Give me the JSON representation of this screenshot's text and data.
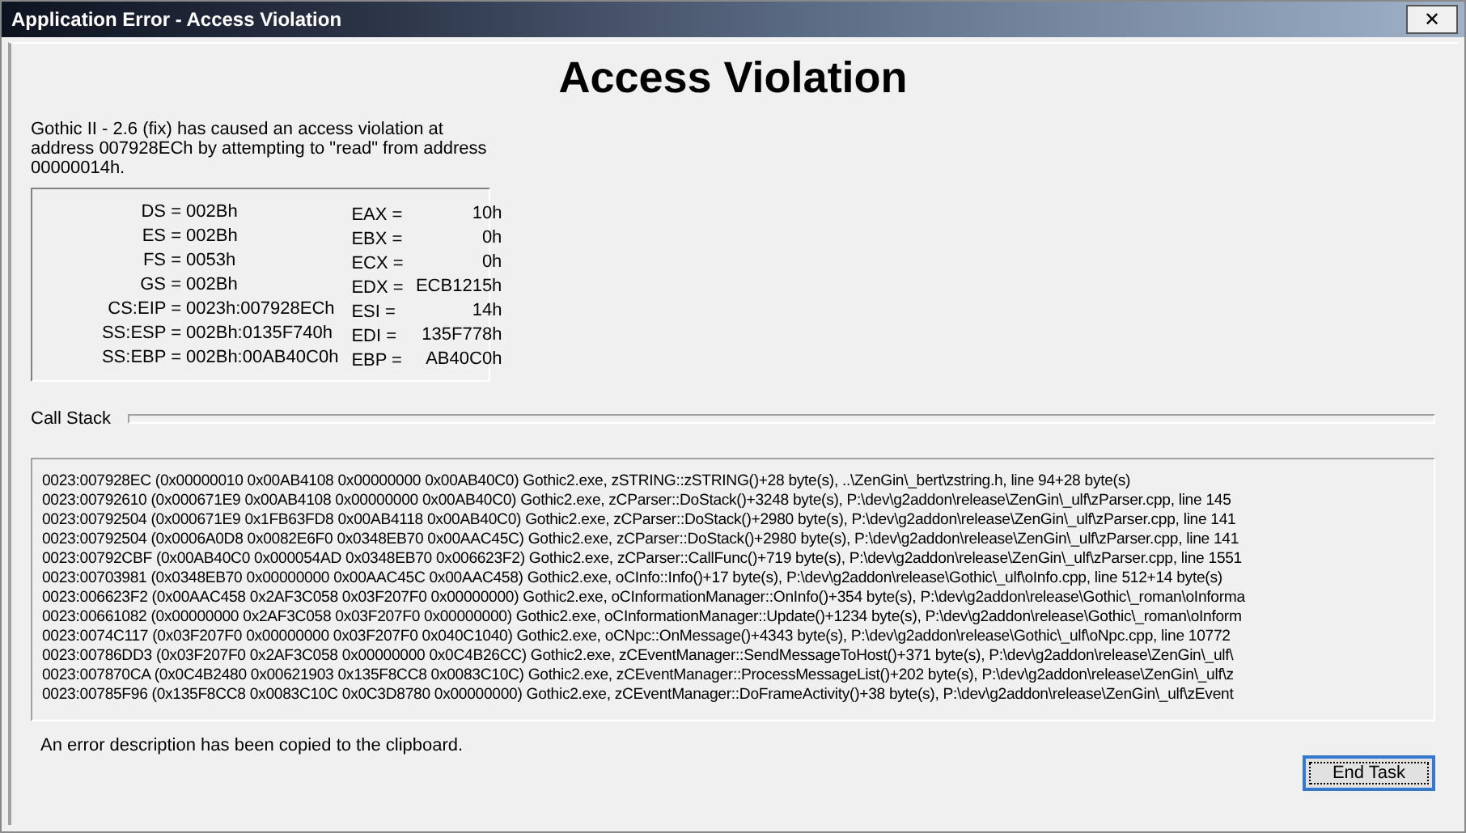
{
  "window": {
    "title": "Application Error - Access Violation",
    "close": "✕"
  },
  "heading": "Access Violation",
  "message": "Gothic II - 2.6 (fix) has caused an access violation at address 007928ECh by attempting to \"read\" from address 00000014h.",
  "segment_registers": [
    {
      "name": "DS =",
      "value": "002Bh"
    },
    {
      "name": "ES =",
      "value": "002Bh"
    },
    {
      "name": "FS =",
      "value": "0053h"
    },
    {
      "name": "GS =",
      "value": "002Bh"
    },
    {
      "name": "CS:EIP =",
      "value": "0023h:007928ECh"
    },
    {
      "name": "SS:ESP =",
      "value": "002Bh:0135F740h"
    },
    {
      "name": "SS:EBP =",
      "value": "002Bh:00AB40C0h"
    }
  ],
  "general_registers": [
    {
      "name": "EAX =",
      "value": "10h"
    },
    {
      "name": "EBX =",
      "value": "0h"
    },
    {
      "name": "ECX =",
      "value": "0h"
    },
    {
      "name": "EDX =",
      "value": "ECB1215h"
    },
    {
      "name": "ESI =",
      "value": "14h"
    },
    {
      "name": "EDI =",
      "value": "135F778h"
    },
    {
      "name": "EBP =",
      "value": "AB40C0h"
    }
  ],
  "call_stack": {
    "label": "Call Stack",
    "lines": [
      "0023:007928EC (0x00000010 0x00AB4108 0x00000000 0x00AB40C0) Gothic2.exe, zSTRING::zSTRING()+28 byte(s), ..\\ZenGin\\_bert\\zstring.h, line 94+28 byte(s)",
      "0023:00792610 (0x000671E9 0x00AB4108 0x00000000 0x00AB40C0) Gothic2.exe, zCParser::DoStack()+3248 byte(s), P:\\dev\\g2addon\\release\\ZenGin\\_ulf\\zParser.cpp, line 145",
      "0023:00792504 (0x000671E9 0x1FB63FD8 0x00AB4118 0x00AB40C0) Gothic2.exe, zCParser::DoStack()+2980 byte(s), P:\\dev\\g2addon\\release\\ZenGin\\_ulf\\zParser.cpp, line 141",
      "0023:00792504 (0x0006A0D8 0x0082E6F0 0x0348EB70 0x00AAC45C) Gothic2.exe, zCParser::DoStack()+2980 byte(s), P:\\dev\\g2addon\\release\\ZenGin\\_ulf\\zParser.cpp, line 141",
      "0023:00792CBF (0x00AB40C0 0x000054AD 0x0348EB70 0x006623F2) Gothic2.exe, zCParser::CallFunc()+719 byte(s), P:\\dev\\g2addon\\release\\ZenGin\\_ulf\\zParser.cpp, line 1551",
      "0023:00703981 (0x0348EB70 0x00000000 0x00AAC45C 0x00AAC458) Gothic2.exe, oCInfo::Info()+17 byte(s), P:\\dev\\g2addon\\release\\Gothic\\_ulf\\oInfo.cpp, line 512+14 byte(s)",
      "0023:006623F2 (0x00AAC458 0x2AF3C058 0x03F207F0 0x00000000) Gothic2.exe, oCInformationManager::OnInfo()+354 byte(s), P:\\dev\\g2addon\\release\\Gothic\\_roman\\oInforma",
      "0023:00661082 (0x00000000 0x2AF3C058 0x03F207F0 0x00000000) Gothic2.exe, oCInformationManager::Update()+1234 byte(s), P:\\dev\\g2addon\\release\\Gothic\\_roman\\oInform",
      "0023:0074C117 (0x03F207F0 0x00000000 0x03F207F0 0x040C1040) Gothic2.exe, oCNpc::OnMessage()+4343 byte(s), P:\\dev\\g2addon\\release\\Gothic\\_ulf\\oNpc.cpp, line 10772",
      "0023:00786DD3 (0x03F207F0 0x2AF3C058 0x00000000 0x0C4B26CC) Gothic2.exe, zCEventManager::SendMessageToHost()+371 byte(s), P:\\dev\\g2addon\\release\\ZenGin\\_ulf\\",
      "0023:007870CA (0x0C4B2480 0x00621903 0x135F8CC8 0x0083C10C) Gothic2.exe, zCEventManager::ProcessMessageList()+202 byte(s), P:\\dev\\g2addon\\release\\ZenGin\\_ulf\\z",
      "0023:00785F96 (0x135F8CC8 0x0083C10C 0x0C3D8780 0x00000000) Gothic2.exe, zCEventManager::DoFrameActivity()+38 byte(s), P:\\dev\\g2addon\\release\\ZenGin\\_ulf\\zEvent"
    ]
  },
  "status": "An error description has been copied to the clipboard.",
  "buttons": [
    {
      "label": "End Task",
      "selected": true
    }
  ]
}
